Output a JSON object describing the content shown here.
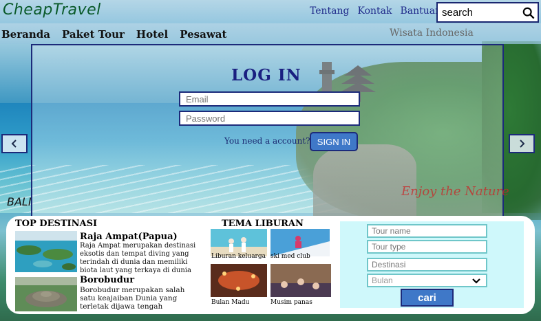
{
  "header": {
    "logo": "CheapTravel",
    "links": [
      "Tentang",
      "Kontak",
      "Bantuan"
    ],
    "search_value": "search"
  },
  "nav": {
    "items": [
      "Beranda",
      "Paket Tour",
      "Hotel",
      "Pesawat"
    ],
    "tagline": "Wisata Indonesia"
  },
  "login": {
    "title": "LOG IN",
    "email_placeholder": "Email",
    "password_placeholder": "Password",
    "need_account": "You need a account?",
    "signin_label": "SIGN IN"
  },
  "hero": {
    "location_label": "BALI",
    "slogan": "Enjoy the Nature"
  },
  "top_destinations": {
    "title": "TOP DESTINASI",
    "items": [
      {
        "name": "Raja Ampat(Papua)",
        "description": "Raja Ampat merupakan destinasi eksotis dan tempat diving yang terindah di dunia dan memiliki biota laut yang terkaya di dunia"
      },
      {
        "name": "Borobudur",
        "description": "Borobudur merupakan salah satu keajaiban Dunia yang terletak dijawa tengah"
      }
    ]
  },
  "themes": {
    "title": "TEMA LIBURAN",
    "items": [
      "Liburan keluarga",
      "ski med club",
      "Bulan Madu",
      "Musim panas"
    ]
  },
  "tour_search": {
    "tour_name_placeholder": "Tour name",
    "tour_type_placeholder": "Tour type",
    "destination_placeholder": "Destinasi",
    "month_value": "Bulan",
    "submit_label": "cari"
  },
  "colors": {
    "accent": "#3f78c8",
    "border": "#1c2a7a",
    "form_bg": "#cff8fb",
    "logo": "#0a5a2a"
  }
}
